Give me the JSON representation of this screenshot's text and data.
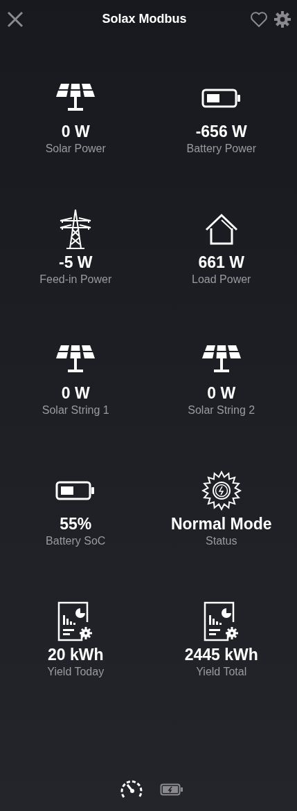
{
  "header": {
    "title": "Solax Modbus"
  },
  "tiles": [
    {
      "kind": "solar",
      "value": "0 W",
      "label": "Solar Power"
    },
    {
      "kind": "battery",
      "value": "-656 W",
      "label": "Battery Power"
    },
    {
      "kind": "grid",
      "value": "-5 W",
      "label": "Feed-in Power"
    },
    {
      "kind": "house",
      "value": "661 W",
      "label": "Load Power"
    },
    {
      "kind": "solar",
      "value": "0 W",
      "label": "Solar String 1"
    },
    {
      "kind": "solar",
      "value": "0 W",
      "label": "Solar String 2"
    },
    {
      "kind": "battery",
      "value": "55%",
      "label": "Battery SoC"
    },
    {
      "kind": "status",
      "value": "Normal Mode",
      "label": "Status"
    },
    {
      "kind": "report",
      "value": "20 kWh",
      "label": "Yield Today"
    },
    {
      "kind": "report",
      "value": "2445 kWh",
      "label": "Yield Total"
    }
  ],
  "bottom_tabs": [
    {
      "kind": "gauge",
      "selected": true
    },
    {
      "kind": "battery",
      "selected": false
    }
  ]
}
